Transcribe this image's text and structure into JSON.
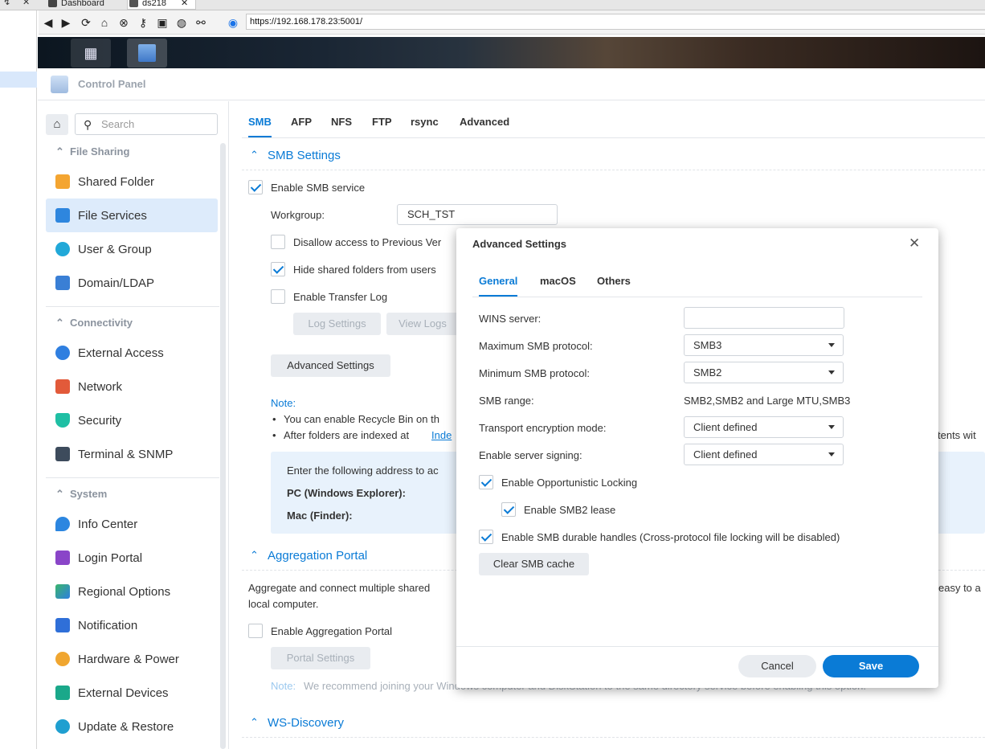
{
  "browser": {
    "tabs": [
      {
        "label": "Dashboard"
      },
      {
        "label": "ds218"
      }
    ],
    "url": "https://192.168.178.23:5001/"
  },
  "window": {
    "title": "Control Panel"
  },
  "sidebar": {
    "search_placeholder": "Search",
    "sections": [
      {
        "title": "File Sharing",
        "items": [
          {
            "label": "Shared Folder"
          },
          {
            "label": "File Services"
          },
          {
            "label": "User & Group"
          },
          {
            "label": "Domain/LDAP"
          }
        ]
      },
      {
        "title": "Connectivity",
        "items": [
          {
            "label": "External Access"
          },
          {
            "label": "Network"
          },
          {
            "label": "Security"
          },
          {
            "label": "Terminal & SNMP"
          }
        ]
      },
      {
        "title": "System",
        "items": [
          {
            "label": "Info Center"
          },
          {
            "label": "Login Portal"
          },
          {
            "label": "Regional Options"
          },
          {
            "label": "Notification"
          },
          {
            "label": "Hardware & Power"
          },
          {
            "label": "External Devices"
          },
          {
            "label": "Update & Restore"
          }
        ]
      }
    ],
    "selected": "File Services"
  },
  "main": {
    "tabs": [
      {
        "label": "SMB"
      },
      {
        "label": "AFP"
      },
      {
        "label": "NFS"
      },
      {
        "label": "FTP"
      },
      {
        "label": "rsync"
      },
      {
        "label": "Advanced"
      }
    ],
    "smb": {
      "title": "SMB Settings",
      "enable_label": "Enable SMB service",
      "workgroup_label": "Workgroup:",
      "workgroup_value": "SCH_TST",
      "disallow_label": "Disallow access to Previous Ver",
      "hide_label": "Hide shared folders from users",
      "transfer_log_label": "Enable Transfer Log",
      "log_settings": "Log Settings",
      "view_logs": "View Logs",
      "advanced_settings": "Advanced Settings",
      "note_title": "Note:",
      "note_1": "You can enable Recycle Bin on th",
      "note_2_prefix": "After folders are indexed at ",
      "note_2_link": "Inde",
      "note_2_tail": "tents wit",
      "info_text": "Enter the following address to ac",
      "pc_label": "PC (Windows Explorer):",
      "mac_label": "Mac (Finder):"
    },
    "aggregation": {
      "title": "Aggregation Portal",
      "desc_1": "Aggregate and connect multiple shared",
      "desc_1_tail": "easy to a",
      "desc_2": "local computer.",
      "enable_label": "Enable Aggregation Portal",
      "portal_settings": "Portal Settings",
      "note_label": "Note:",
      "note_text": "We recommend joining your Windows computer and DiskStation to the same directory service before enabling this option."
    },
    "ws_discovery": {
      "title": "WS-Discovery"
    }
  },
  "modal": {
    "title": "Advanced Settings",
    "tabs": [
      {
        "label": "General"
      },
      {
        "label": "macOS"
      },
      {
        "label": "Others"
      }
    ],
    "fields": {
      "wins_label": "WINS server:",
      "wins_value": "",
      "max_label": "Maximum SMB protocol:",
      "max_value": "SMB3",
      "min_label": "Minimum SMB protocol:",
      "min_value": "SMB2",
      "range_label": "SMB range:",
      "range_value": "SMB2,SMB2 and Large MTU,SMB3",
      "transport_label": "Transport encryption mode:",
      "transport_value": "Client defined",
      "signing_label": "Enable server signing:",
      "signing_value": "Client defined"
    },
    "checks": {
      "oplock": "Enable Opportunistic Locking",
      "lease": "Enable SMB2 lease",
      "durable": "Enable SMB durable handles (Cross-protocol file locking will be disabled)"
    },
    "clear_cache": "Clear SMB cache",
    "cancel": "Cancel",
    "save": "Save"
  }
}
